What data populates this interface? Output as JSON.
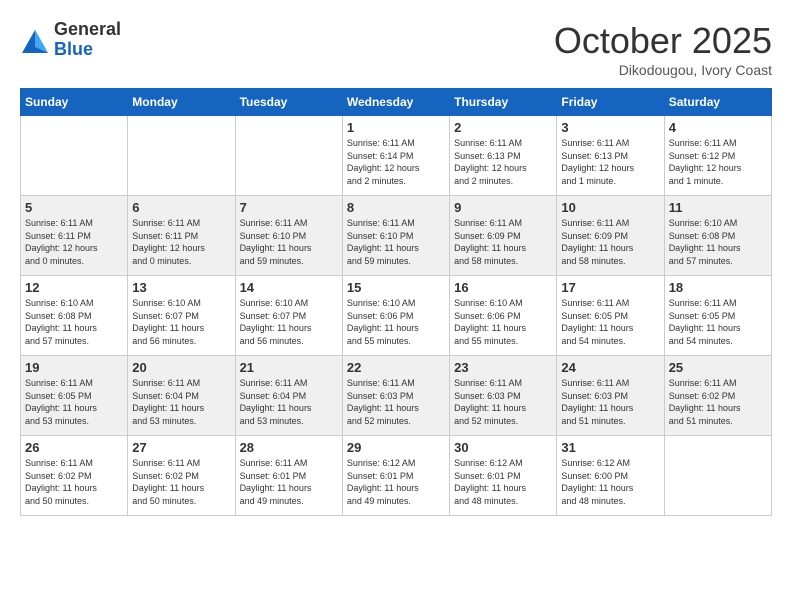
{
  "header": {
    "logo_line1": "General",
    "logo_line2": "Blue",
    "month": "October 2025",
    "location": "Dikodougou, Ivory Coast"
  },
  "days_of_week": [
    "Sunday",
    "Monday",
    "Tuesday",
    "Wednesday",
    "Thursday",
    "Friday",
    "Saturday"
  ],
  "weeks": [
    [
      {
        "day": "",
        "info": ""
      },
      {
        "day": "",
        "info": ""
      },
      {
        "day": "",
        "info": ""
      },
      {
        "day": "1",
        "info": "Sunrise: 6:11 AM\nSunset: 6:14 PM\nDaylight: 12 hours\nand 2 minutes."
      },
      {
        "day": "2",
        "info": "Sunrise: 6:11 AM\nSunset: 6:13 PM\nDaylight: 12 hours\nand 2 minutes."
      },
      {
        "day": "3",
        "info": "Sunrise: 6:11 AM\nSunset: 6:13 PM\nDaylight: 12 hours\nand 1 minute."
      },
      {
        "day": "4",
        "info": "Sunrise: 6:11 AM\nSunset: 6:12 PM\nDaylight: 12 hours\nand 1 minute."
      }
    ],
    [
      {
        "day": "5",
        "info": "Sunrise: 6:11 AM\nSunset: 6:11 PM\nDaylight: 12 hours\nand 0 minutes."
      },
      {
        "day": "6",
        "info": "Sunrise: 6:11 AM\nSunset: 6:11 PM\nDaylight: 12 hours\nand 0 minutes."
      },
      {
        "day": "7",
        "info": "Sunrise: 6:11 AM\nSunset: 6:10 PM\nDaylight: 11 hours\nand 59 minutes."
      },
      {
        "day": "8",
        "info": "Sunrise: 6:11 AM\nSunset: 6:10 PM\nDaylight: 11 hours\nand 59 minutes."
      },
      {
        "day": "9",
        "info": "Sunrise: 6:11 AM\nSunset: 6:09 PM\nDaylight: 11 hours\nand 58 minutes."
      },
      {
        "day": "10",
        "info": "Sunrise: 6:11 AM\nSunset: 6:09 PM\nDaylight: 11 hours\nand 58 minutes."
      },
      {
        "day": "11",
        "info": "Sunrise: 6:10 AM\nSunset: 6:08 PM\nDaylight: 11 hours\nand 57 minutes."
      }
    ],
    [
      {
        "day": "12",
        "info": "Sunrise: 6:10 AM\nSunset: 6:08 PM\nDaylight: 11 hours\nand 57 minutes."
      },
      {
        "day": "13",
        "info": "Sunrise: 6:10 AM\nSunset: 6:07 PM\nDaylight: 11 hours\nand 56 minutes."
      },
      {
        "day": "14",
        "info": "Sunrise: 6:10 AM\nSunset: 6:07 PM\nDaylight: 11 hours\nand 56 minutes."
      },
      {
        "day": "15",
        "info": "Sunrise: 6:10 AM\nSunset: 6:06 PM\nDaylight: 11 hours\nand 55 minutes."
      },
      {
        "day": "16",
        "info": "Sunrise: 6:10 AM\nSunset: 6:06 PM\nDaylight: 11 hours\nand 55 minutes."
      },
      {
        "day": "17",
        "info": "Sunrise: 6:11 AM\nSunset: 6:05 PM\nDaylight: 11 hours\nand 54 minutes."
      },
      {
        "day": "18",
        "info": "Sunrise: 6:11 AM\nSunset: 6:05 PM\nDaylight: 11 hours\nand 54 minutes."
      }
    ],
    [
      {
        "day": "19",
        "info": "Sunrise: 6:11 AM\nSunset: 6:05 PM\nDaylight: 11 hours\nand 53 minutes."
      },
      {
        "day": "20",
        "info": "Sunrise: 6:11 AM\nSunset: 6:04 PM\nDaylight: 11 hours\nand 53 minutes."
      },
      {
        "day": "21",
        "info": "Sunrise: 6:11 AM\nSunset: 6:04 PM\nDaylight: 11 hours\nand 53 minutes."
      },
      {
        "day": "22",
        "info": "Sunrise: 6:11 AM\nSunset: 6:03 PM\nDaylight: 11 hours\nand 52 minutes."
      },
      {
        "day": "23",
        "info": "Sunrise: 6:11 AM\nSunset: 6:03 PM\nDaylight: 11 hours\nand 52 minutes."
      },
      {
        "day": "24",
        "info": "Sunrise: 6:11 AM\nSunset: 6:03 PM\nDaylight: 11 hours\nand 51 minutes."
      },
      {
        "day": "25",
        "info": "Sunrise: 6:11 AM\nSunset: 6:02 PM\nDaylight: 11 hours\nand 51 minutes."
      }
    ],
    [
      {
        "day": "26",
        "info": "Sunrise: 6:11 AM\nSunset: 6:02 PM\nDaylight: 11 hours\nand 50 minutes."
      },
      {
        "day": "27",
        "info": "Sunrise: 6:11 AM\nSunset: 6:02 PM\nDaylight: 11 hours\nand 50 minutes."
      },
      {
        "day": "28",
        "info": "Sunrise: 6:11 AM\nSunset: 6:01 PM\nDaylight: 11 hours\nand 49 minutes."
      },
      {
        "day": "29",
        "info": "Sunrise: 6:12 AM\nSunset: 6:01 PM\nDaylight: 11 hours\nand 49 minutes."
      },
      {
        "day": "30",
        "info": "Sunrise: 6:12 AM\nSunset: 6:01 PM\nDaylight: 11 hours\nand 48 minutes."
      },
      {
        "day": "31",
        "info": "Sunrise: 6:12 AM\nSunset: 6:00 PM\nDaylight: 11 hours\nand 48 minutes."
      },
      {
        "day": "",
        "info": ""
      }
    ]
  ],
  "row_shading": [
    false,
    true,
    false,
    true,
    false
  ]
}
